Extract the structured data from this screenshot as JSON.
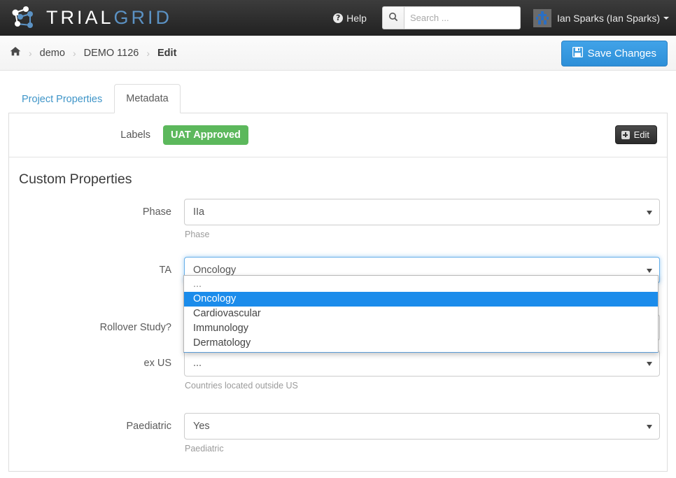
{
  "navbar": {
    "brand_trial": "TRIAL",
    "brand_grid": "GRID",
    "help_label": "Help",
    "help_icon": "question-circle-icon",
    "search_placeholder": "Search ...",
    "search_value": "",
    "search_icon": "search-icon",
    "user_name": "Ian Sparks (Ian Sparks)",
    "avatar_icon": "identicon-avatar"
  },
  "breadcrumb": {
    "home_icon": "home-icon",
    "separator": "›",
    "items": [
      {
        "label": "demo",
        "active": false
      },
      {
        "label": "DEMO 1126",
        "active": false
      },
      {
        "label": "Edit",
        "active": true
      }
    ]
  },
  "toolbar": {
    "save_label": "Save Changes",
    "save_icon": "floppy-save-icon"
  },
  "tabs": [
    {
      "label": "Project Properties",
      "active": false
    },
    {
      "label": "Metadata",
      "active": true
    }
  ],
  "panel": {
    "labels_label": "Labels",
    "label_badge": "UAT Approved",
    "badge_color": "#5cb85c",
    "edit_label": "Edit",
    "edit_icon": "plus-square-icon",
    "section_title": "Custom Properties"
  },
  "fields": [
    {
      "label": "Phase",
      "value": "IIa",
      "help": "Phase",
      "focused": false
    },
    {
      "label": "TA",
      "value": "Oncology",
      "help": "",
      "focused": true
    },
    {
      "label": "Rollover Study?",
      "value": "",
      "help": "",
      "focused": false
    },
    {
      "label": "ex US",
      "value": "...",
      "help": "Countries located outside US",
      "focused": false
    },
    {
      "label": "Paediatric",
      "value": "Yes",
      "help": "Paediatric",
      "focused": false
    }
  ],
  "dropdown": {
    "open": true,
    "highlight_color": "#1b8ceb",
    "options": [
      {
        "label": "...",
        "selected": false,
        "muted": true
      },
      {
        "label": "Oncology",
        "selected": true,
        "muted": false
      },
      {
        "label": "Cardiovascular",
        "selected": false,
        "muted": false
      },
      {
        "label": "Immunology",
        "selected": false,
        "muted": false
      },
      {
        "label": "Dermatology",
        "selected": false,
        "muted": false
      }
    ]
  }
}
